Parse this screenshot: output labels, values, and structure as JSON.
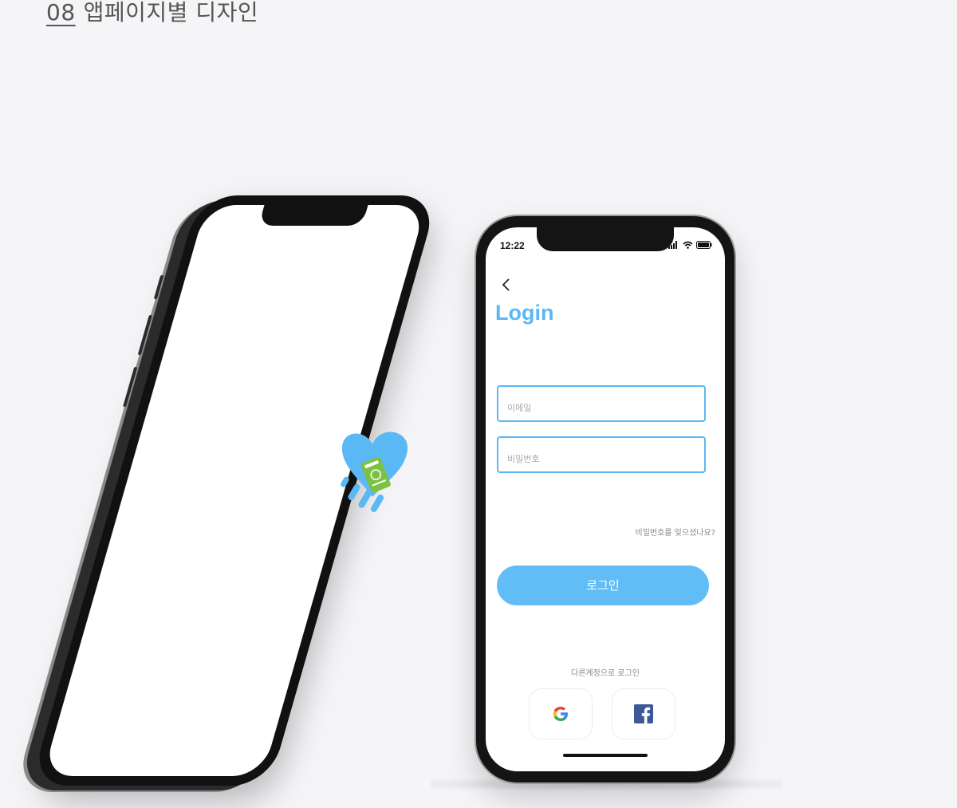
{
  "section": {
    "number": "08",
    "title": "앱페이지별 디자인"
  },
  "right_phone": {
    "status_time": "12:22",
    "title": "Login",
    "email_placeholder": "이메일",
    "password_placeholder": "비밀번호",
    "forgot_password": "비밀번호를 잊으셨나요?",
    "login_button": "로그인",
    "other_accounts": "다른계정으로 로그인"
  },
  "colors": {
    "accent": "#5ab8f4",
    "button": "#62bdf7",
    "logo_green": "#7cc242",
    "background": "#f5f5f8"
  },
  "icons": [
    "back-chevron-icon",
    "location-arrow-icon",
    "signal-icon",
    "wifi-icon",
    "battery-icon",
    "google-icon",
    "facebook-icon",
    "splash-heart-logo"
  ]
}
